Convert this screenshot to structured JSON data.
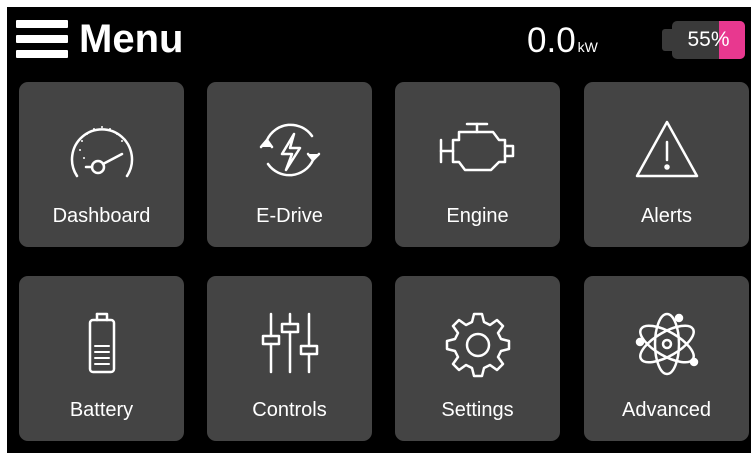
{
  "header": {
    "menu_icon": "hamburger-icon",
    "title": "Menu",
    "power_value": "0.0",
    "power_unit": "kW",
    "battery_percent": "55",
    "battery_symbol": "%",
    "battery_level": 0.55,
    "accent_color": "#e8388f"
  },
  "tiles": [
    {
      "label": "Dashboard",
      "icon": "speedometer-icon"
    },
    {
      "label": "E-Drive",
      "icon": "e-drive-icon"
    },
    {
      "label": "Engine",
      "icon": "engine-icon"
    },
    {
      "label": "Alerts",
      "icon": "warning-triangle-icon"
    },
    {
      "label": "Battery",
      "icon": "battery-icon"
    },
    {
      "label": "Controls",
      "icon": "sliders-icon"
    },
    {
      "label": "Settings",
      "icon": "gear-icon"
    },
    {
      "label": "Advanced",
      "icon": "atom-icon"
    }
  ],
  "colors": {
    "background": "#000000",
    "tile": "#444444",
    "battery_track": "#3a3a3a",
    "text": "#ffffff"
  }
}
